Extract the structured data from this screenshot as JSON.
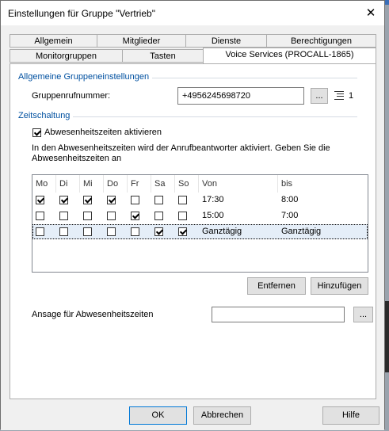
{
  "window": {
    "title": "Einstellungen für Gruppe \"Vertrieb\"",
    "close_glyph": "✕"
  },
  "tabs": {
    "row1": [
      "Allgemein",
      "Mitglieder",
      "Dienste",
      "Berechtigungen"
    ],
    "row2": [
      "Monitorgruppen",
      "Tasten",
      "Voice Services (PROCALL-1865)"
    ],
    "active": "Voice Services (PROCALL-1865)"
  },
  "general": {
    "group_title": "Allgemeine Gruppeneinstellungen",
    "number_label": "Gruppenrufnummer:",
    "number_value": "+4956245698720",
    "browse_label": "...",
    "count": "1"
  },
  "schedule": {
    "group_title": "Zeitschaltung",
    "enable_label": "Abwesenheitszeiten aktivieren",
    "enable_checked": true,
    "description": "In den Abwesenheitszeiten wird der Anrufbeantworter aktiviert. Geben Sie die Abwesenheitszeiten an",
    "columns": [
      "Mo",
      "Di",
      "Mi",
      "Do",
      "Fr",
      "Sa",
      "So",
      "Von",
      "bis"
    ],
    "rows": [
      {
        "days": [
          true,
          true,
          true,
          true,
          false,
          false,
          false
        ],
        "from": "17:30",
        "to": "8:00",
        "selected": false
      },
      {
        "days": [
          false,
          false,
          false,
          false,
          true,
          false,
          false
        ],
        "from": "15:00",
        "to": "7:00",
        "selected": false
      },
      {
        "days": [
          false,
          false,
          false,
          false,
          false,
          true,
          true
        ],
        "from": "Ganztägig",
        "to": "Ganztägig",
        "selected": true
      }
    ],
    "remove_label": "Entfernen",
    "add_label": "Hinzufügen",
    "announcement_label": "Ansage für Abwesenheitszeiten",
    "announcement_value": "",
    "announcement_browse": "..."
  },
  "footer": {
    "ok": "OK",
    "cancel": "Abbrechen",
    "help": "Hilfe"
  },
  "colors": {
    "group_title": "#0050a0",
    "selection": "#e5eef8",
    "primary_border": "#0078d7"
  }
}
